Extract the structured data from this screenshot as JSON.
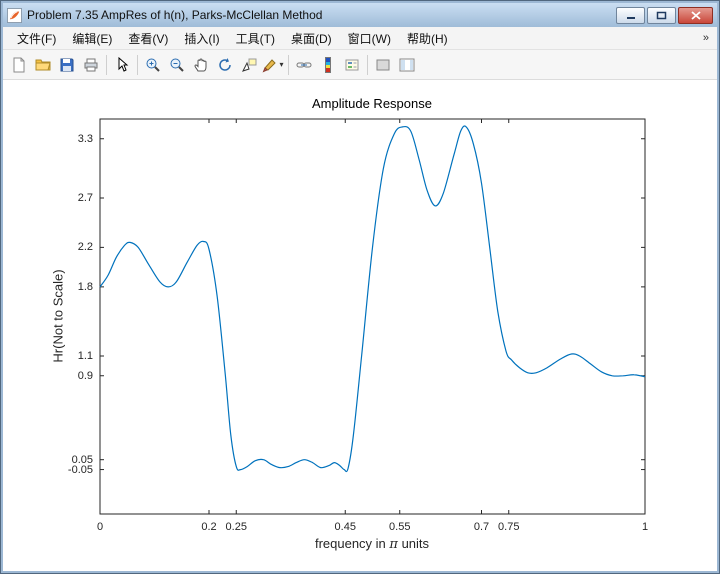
{
  "window": {
    "title": "Problem 7.35 AmpRes of h(n), Parks-McClellan Method",
    "controls": [
      "minimize",
      "maximize",
      "close"
    ]
  },
  "menubar": {
    "items": [
      "文件(F)",
      "编辑(E)",
      "查看(V)",
      "插入(I)",
      "工具(T)",
      "桌面(D)",
      "窗口(W)",
      "帮助(H)"
    ],
    "overflow_icon": "»"
  },
  "toolbar": {
    "buttons": [
      "new-document",
      "open-folder",
      "save",
      "print",
      "pointer",
      "zoom-in",
      "zoom-out",
      "pan",
      "rotate-3d",
      "data-cursor",
      "brush",
      "link-plot",
      "insert-colorbar",
      "insert-legend",
      "hide-plot-tools",
      "show-plot-tools"
    ]
  },
  "chart_data": {
    "type": "line",
    "title": "Amplitude Response",
    "xlabel": "frequency in π units",
    "xlabel_parts": {
      "prefix": "frequency in ",
      "pi": "π",
      "suffix": " units"
    },
    "ylabel": "Hr(Not to Scale)",
    "xlim": [
      0,
      1
    ],
    "ylim": [
      -0.5,
      3.5
    ],
    "xtick_values": [
      0,
      0.2,
      0.25,
      0.45,
      0.55,
      0.7,
      0.75,
      1
    ],
    "xtick_labels": [
      "0",
      "0.2",
      "0.25",
      "0.45",
      "0.55",
      "0.7",
      "0.75",
      "1"
    ],
    "ytick_values": [
      -0.05,
      0.05,
      0.9,
      1.1,
      1.8,
      2.2,
      2.7,
      3.3
    ],
    "ytick_labels": [
      "-0.05",
      "0.05",
      "0.9",
      "1.1",
      "1.8",
      "2.2",
      "2.7",
      "3.3"
    ],
    "grid": false,
    "legend": null,
    "line_color": "#0072BD",
    "axis_color": "#262626",
    "bands_note": "Parks-McClellan multiband amplitude: [0,0.2]≈2 (±0.2), [0.25,0.45]≈0 (±0.05), [0.55,0.7]≈3 (±0.3), [0.75,1]≈1 (±0.1)",
    "x": [
      0,
      0.015,
      0.03,
      0.045,
      0.055,
      0.07,
      0.09,
      0.11,
      0.125,
      0.14,
      0.16,
      0.178,
      0.19,
      0.2,
      0.215,
      0.23,
      0.24,
      0.25,
      0.258,
      0.27,
      0.285,
      0.3,
      0.315,
      0.33,
      0.345,
      0.36,
      0.375,
      0.39,
      0.405,
      0.42,
      0.43,
      0.44,
      0.448,
      0.455,
      0.465,
      0.48,
      0.5,
      0.52,
      0.54,
      0.555,
      0.57,
      0.585,
      0.6,
      0.615,
      0.63,
      0.65,
      0.662,
      0.672,
      0.685,
      0.7,
      0.715,
      0.73,
      0.745,
      0.755,
      0.77,
      0.785,
      0.8,
      0.82,
      0.845,
      0.865,
      0.88,
      0.9,
      0.92,
      0.94,
      0.96,
      0.98,
      1
    ],
    "y": [
      1.8,
      1.92,
      2.1,
      2.22,
      2.25,
      2.2,
      2.02,
      1.85,
      1.8,
      1.85,
      2.05,
      2.22,
      2.26,
      2.18,
      1.7,
      0.9,
      0.3,
      -0.02,
      -0.05,
      -0.02,
      0.04,
      0.05,
      0,
      -0.03,
      -0.02,
      0.02,
      0.05,
      0.02,
      -0.03,
      -0.01,
      0.02,
      -0.01,
      -0.05,
      -0.04,
      0.3,
      1.1,
      2.2,
      3,
      3.35,
      3.42,
      3.38,
      3.1,
      2.78,
      2.62,
      2.75,
      3.15,
      3.38,
      3.42,
      3.25,
      2.85,
      2.2,
      1.55,
      1.15,
      1.06,
      0.98,
      0.93,
      0.93,
      0.98,
      1.07,
      1.12,
      1.1,
      1.02,
      0.94,
      0.9,
      0.9,
      0.91,
      0.89
    ]
  }
}
